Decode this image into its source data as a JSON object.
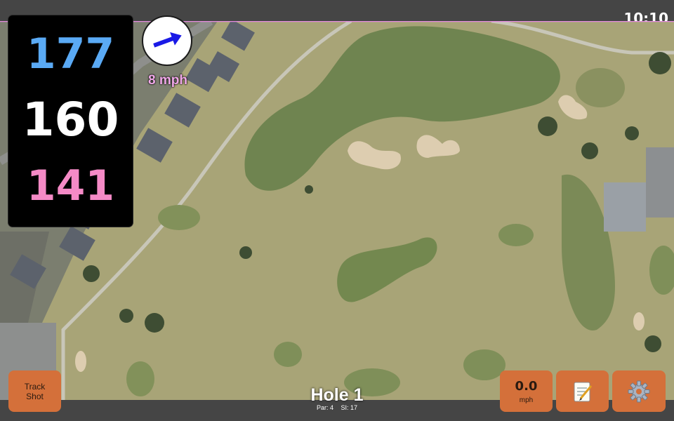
{
  "status_bar": {
    "time": "10:10"
  },
  "distances": {
    "back": "177",
    "middle": "160",
    "front": "141",
    "colors": {
      "back": "#5aaaf5",
      "middle": "#ffffff",
      "front": "#f58ac6"
    }
  },
  "wind": {
    "speed_label": "8 mph",
    "direction_icon": "arrow-icon",
    "arrow_color": "#1a1ae6",
    "label_color": "#f0a8e8"
  },
  "buttons": {
    "track_shot": {
      "line1": "Track",
      "line2": "Shot"
    },
    "speed": {
      "value": "0.0",
      "unit": "mph"
    },
    "notes": {
      "icon": "notepad-icon"
    },
    "settings": {
      "icon": "gear-icon"
    },
    "color": "#d4703a"
  },
  "hole": {
    "title": "Hole 1",
    "par": "Par: 4",
    "si": "SI: 17"
  }
}
